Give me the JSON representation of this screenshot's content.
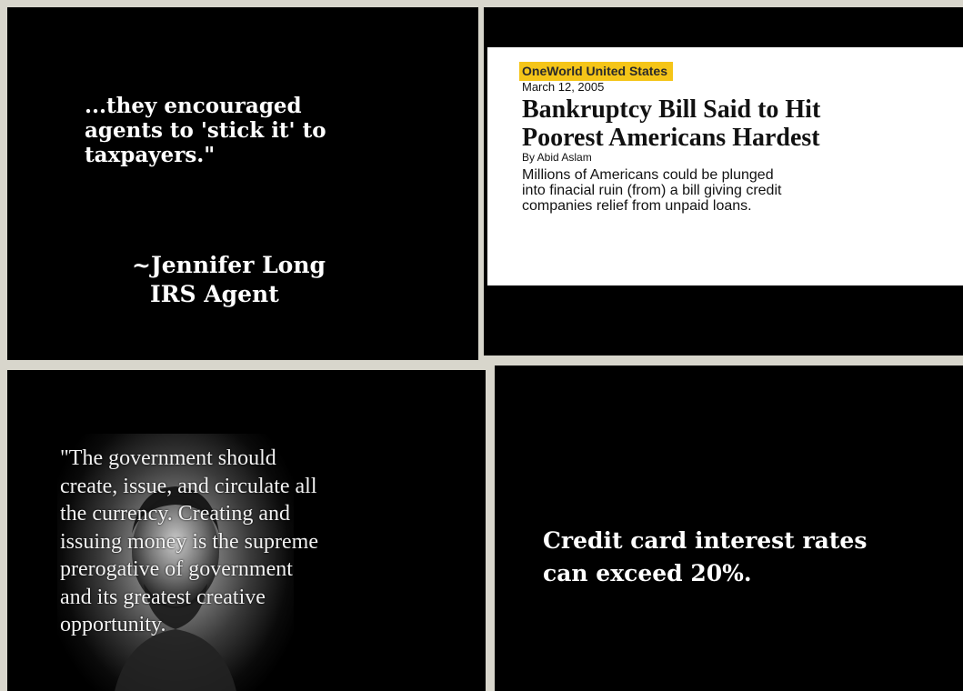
{
  "panel_quote_irs": {
    "quote": "...they encouraged\nagents to 'stick it' to\ntaxpayers.\"",
    "author": "~Jennifer Long",
    "author_title": "IRS Agent"
  },
  "panel_news_clipping": {
    "source": "OneWorld United States",
    "source_color": "#f5c518",
    "date": "March 12, 2005",
    "headline": "Bankruptcy Bill Said to Hit\nPoorest Americans Hardest",
    "byline": "By Abid Aslam",
    "body": "Millions of Americans could be plunged\ninto finacial ruin (from) a bill giving credit\ncompanies relief from unpaid loans."
  },
  "panel_quote_government": {
    "quote": "   \"The government should\ncreate, issue, and circulate all\nthe currency. Creating and\nissuing money is the supreme\nprerogative of government\nand its greatest creative\nopportunity."
  },
  "panel_credit_card": {
    "text": "Credit card interest rates\ncan exceed 20%."
  }
}
